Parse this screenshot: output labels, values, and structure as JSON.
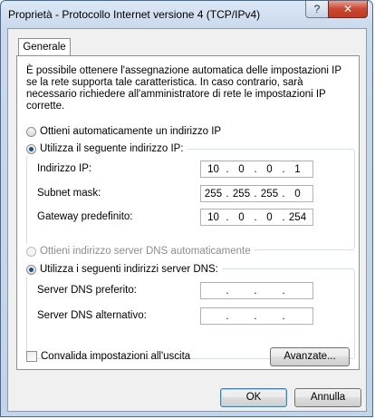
{
  "window": {
    "title": "Proprietà - Protocollo Internet versione 4 (TCP/IPv4)",
    "help_glyph": "?",
    "close_glyph": "✕"
  },
  "tabs": [
    {
      "label": "Generale"
    }
  ],
  "intro_text": "È possibile ottenere l'assegnazione automatica delle impostazioni IP se la rete supporta tale caratteristica. In caso contrario, sarà necessario richiedere all'amministratore di rete le impostazioni IP corrette.",
  "ip": {
    "auto_label": "Ottieni automaticamente un indirizzo IP",
    "auto_selected": false,
    "manual_label": "Utilizza il seguente indirizzo IP:",
    "manual_selected": true,
    "fields": [
      {
        "label": "Indirizzo IP:",
        "octets": [
          "10",
          "0",
          "0",
          "1"
        ]
      },
      {
        "label": "Subnet mask:",
        "octets": [
          "255",
          "255",
          "255",
          "0"
        ]
      },
      {
        "label": "Gateway predefinito:",
        "octets": [
          "10",
          "0",
          "0",
          "254"
        ]
      }
    ]
  },
  "dns": {
    "auto_label": "Ottieni indirizzo server DNS automaticamente",
    "auto_enabled": false,
    "manual_label": "Utilizza i seguenti indirizzi server DNS:",
    "manual_selected": true,
    "fields": [
      {
        "label": "Server DNS preferito:",
        "octets": [
          "",
          "",
          "",
          ""
        ]
      },
      {
        "label": "Server DNS alternativo:",
        "octets": [
          "",
          "",
          "",
          ""
        ]
      }
    ]
  },
  "validate_label": "Convalida impostazioni all'uscita",
  "validate_checked": false,
  "buttons": {
    "advanced": "Avanzate...",
    "ok": "OK",
    "cancel": "Annulla"
  },
  "colors": {
    "title_gradient_top": "#dbe8f6",
    "close_button": "#c8462f",
    "default_button_border": "#3c7fb1"
  }
}
